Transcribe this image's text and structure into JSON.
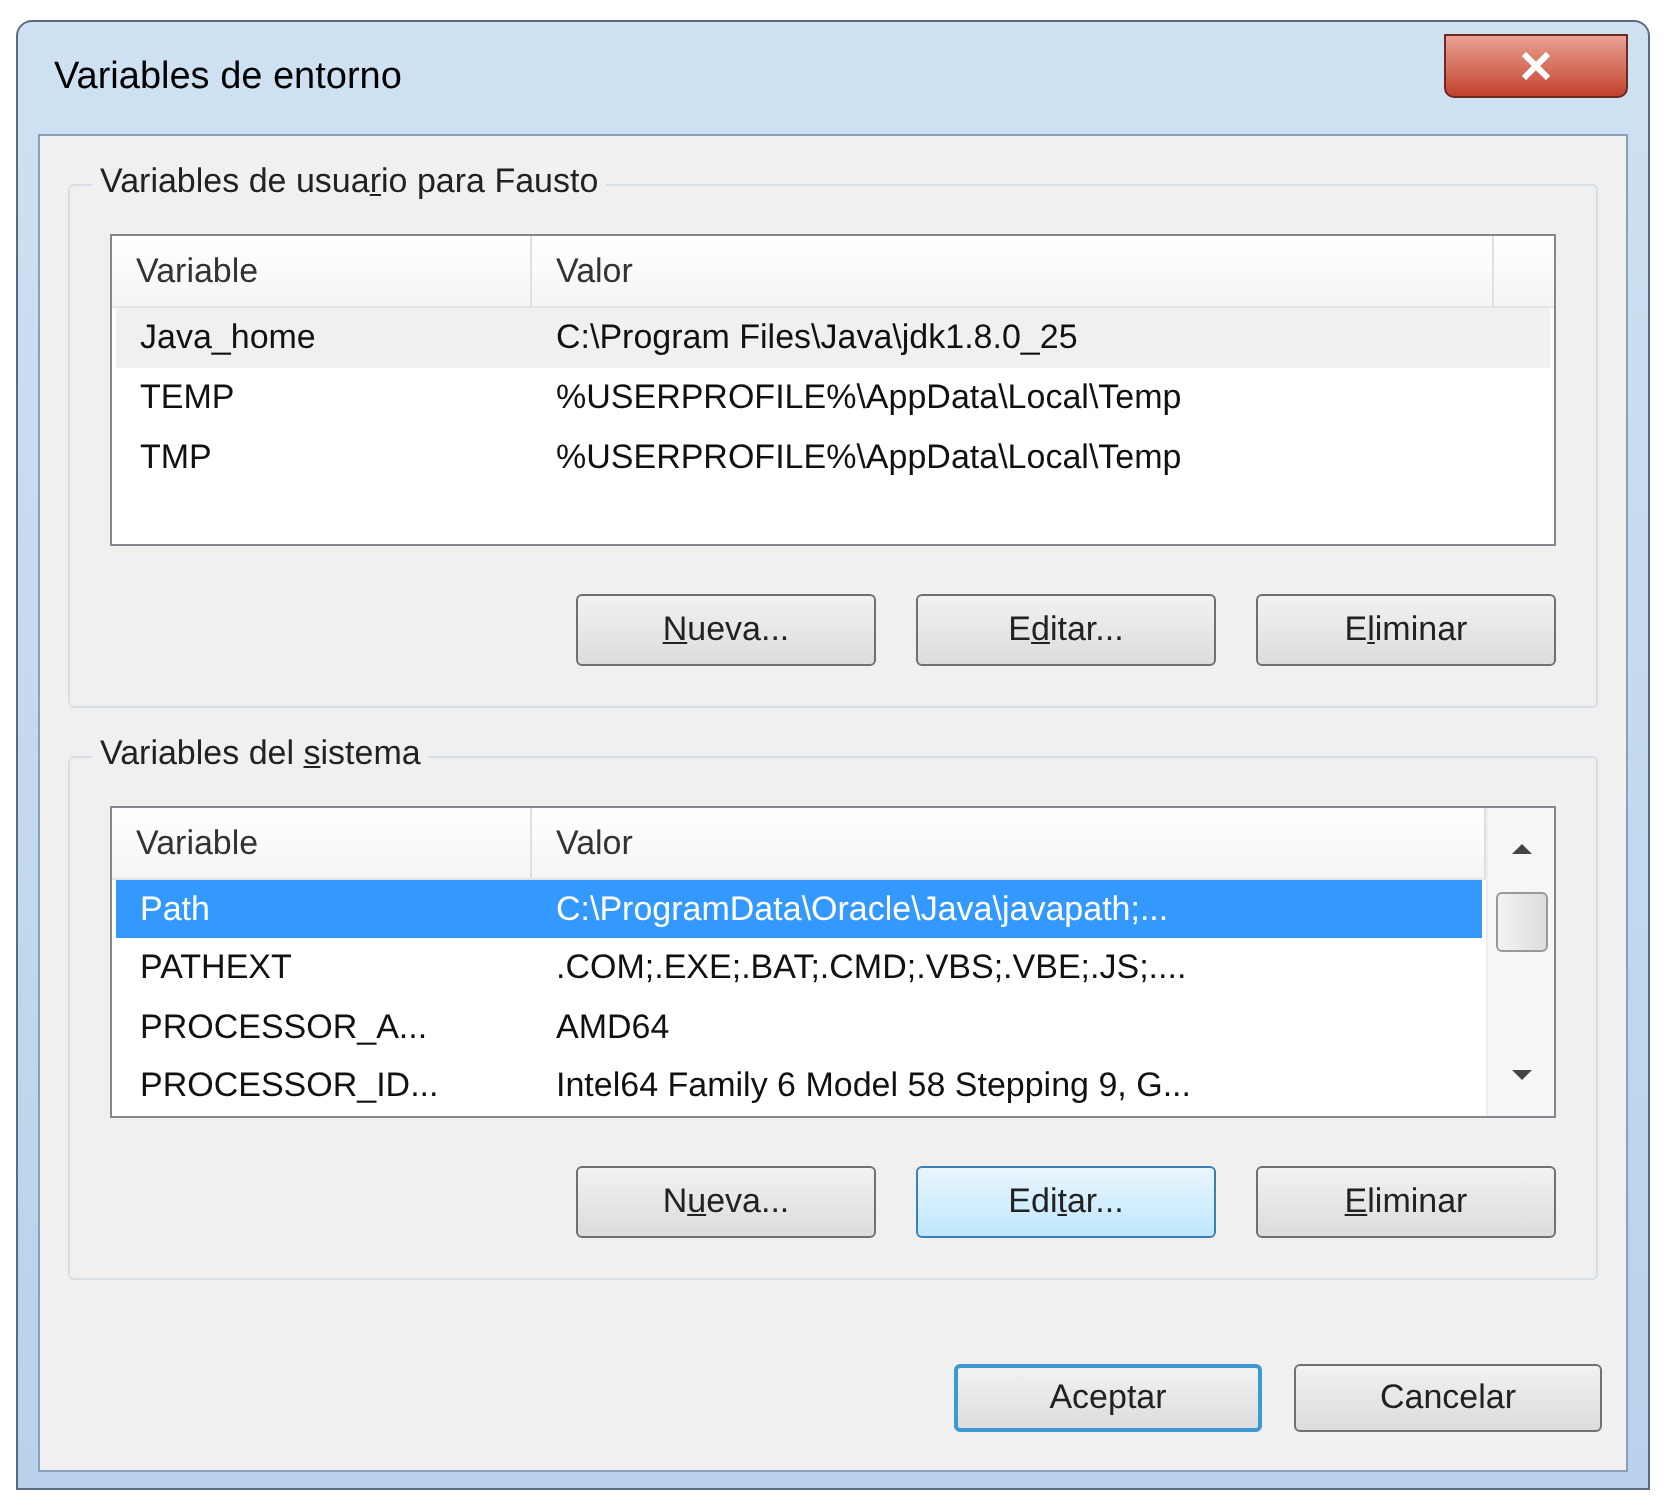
{
  "window": {
    "title": "Variables de entorno"
  },
  "user_group": {
    "label": {
      "before": "Variables de usua",
      "key": "r",
      "after": "io para Fausto"
    },
    "columns": [
      "Variable",
      "Valor"
    ],
    "rows": [
      {
        "variable": "Java_home",
        "value": "C:\\Program Files\\Java\\jdk1.8.0_25",
        "selected": false,
        "hover": true
      },
      {
        "variable": "TEMP",
        "value": "%USERPROFILE%\\AppData\\Local\\Temp",
        "selected": false,
        "hover": false
      },
      {
        "variable": "TMP",
        "value": "%USERPROFILE%\\AppData\\Local\\Temp",
        "selected": false,
        "hover": false
      }
    ],
    "buttons": [
      {
        "label": {
          "key": "N",
          "after": "ueva..."
        },
        "focused": false
      },
      {
        "label": {
          "before": "E",
          "key": "d",
          "after": "itar..."
        },
        "focused": false
      },
      {
        "label": {
          "before": "E",
          "key": "l",
          "after": "iminar"
        },
        "focused": false
      }
    ]
  },
  "system_group": {
    "label": {
      "before": "Variables del ",
      "key": "s",
      "after": "istema"
    },
    "columns": [
      "Variable",
      "Valor"
    ],
    "rows": [
      {
        "variable": "Path",
        "value": "C:\\ProgramData\\Oracle\\Java\\javapath;...",
        "selected": true
      },
      {
        "variable": "PATHEXT",
        "value": ".COM;.EXE;.BAT;.CMD;.VBS;.VBE;.JS;....",
        "selected": false
      },
      {
        "variable": "PROCESSOR_A...",
        "value": "AMD64",
        "selected": false
      },
      {
        "variable": "PROCESSOR_ID...",
        "value": "Intel64 Family 6 Model 58 Stepping 9, G...",
        "selected": false
      }
    ],
    "buttons": [
      {
        "label": {
          "before": "N",
          "key": "u",
          "after": "eva..."
        },
        "focused": false
      },
      {
        "label": {
          "before": "Edi",
          "key": "t",
          "after": "ar..."
        },
        "focused": true
      },
      {
        "label": {
          "key": "E",
          "after": "liminar"
        },
        "focused": false
      }
    ]
  },
  "footer_buttons": [
    {
      "label": "Aceptar",
      "default": true
    },
    {
      "label": "Cancelar",
      "default": false
    }
  ]
}
